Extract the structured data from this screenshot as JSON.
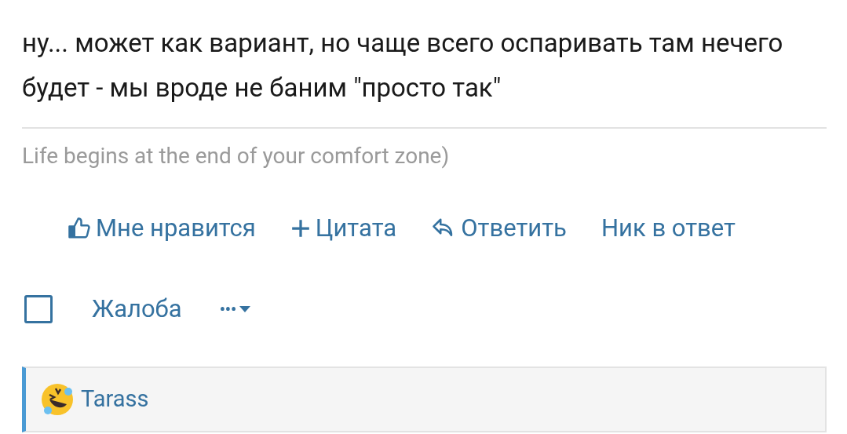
{
  "post": {
    "text": "ну... может как вариант, но чаще всего оспаривать там нечего будет - мы вроде не баним \"просто так\""
  },
  "signature": "Life begins at the end of your comfort zone)",
  "actions": [
    {
      "kind": "like",
      "label": "Мне нравится"
    },
    {
      "kind": "quote",
      "label": "Цитата"
    },
    {
      "kind": "reply",
      "label": "Ответить"
    },
    {
      "kind": "plain",
      "label": "Ник в ответ"
    }
  ],
  "select": {
    "checked": false
  },
  "report": "Жалоба",
  "more": "•••",
  "reactions": {
    "user": "Tarass"
  }
}
